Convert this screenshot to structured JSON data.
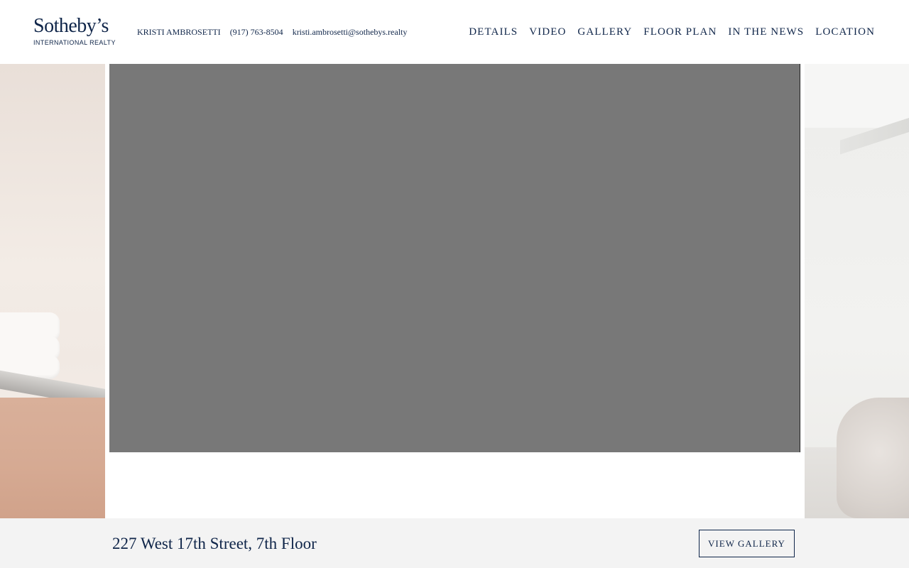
{
  "brand": {
    "logo_main": "Sotheby’s",
    "logo_sub": "INTERNATIONAL REALTY"
  },
  "agent": {
    "name": "KRISTI AMBROSETTI",
    "phone": "(917) 763-8504",
    "email": "kristi.ambrosetti@sothebys.realty"
  },
  "nav": {
    "items": [
      {
        "label": "DETAILS"
      },
      {
        "label": "VIDEO"
      },
      {
        "label": "GALLERY"
      },
      {
        "label": "FLOOR PLAN"
      },
      {
        "label": "IN THE NEWS"
      },
      {
        "label": "LOCATION"
      }
    ]
  },
  "listing": {
    "address": "227 West 17th Street, 7th Floor",
    "gallery_button": "VIEW GALLERY"
  },
  "colors": {
    "brand_navy": "#0f2549",
    "video_placeholder": "#787878",
    "footer_bar": "#f3f3f3"
  }
}
